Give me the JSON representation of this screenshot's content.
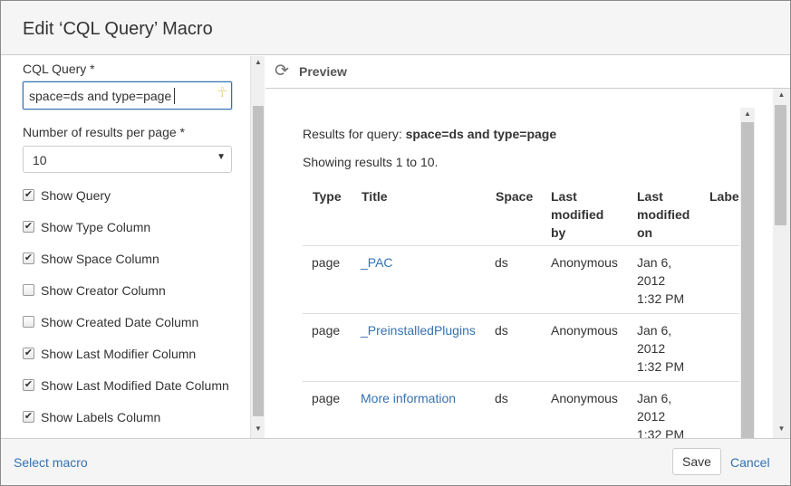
{
  "dialog": {
    "title": "Edit ‘CQL Query’ Macro"
  },
  "form": {
    "query_label": "CQL Query *",
    "query_value": "space=ds and type=page",
    "results_label": "Number of results per page *",
    "results_value": "10",
    "checkboxes": [
      {
        "label": "Show Query",
        "checked": true
      },
      {
        "label": "Show Type Column",
        "checked": true
      },
      {
        "label": "Show Space Column",
        "checked": true
      },
      {
        "label": "Show Creator Column",
        "checked": false
      },
      {
        "label": "Show Created Date Column",
        "checked": false
      },
      {
        "label": "Show Last Modifier Column",
        "checked": true
      },
      {
        "label": "Show Last Modified Date Column",
        "checked": true
      },
      {
        "label": "Show Labels Column",
        "checked": true
      }
    ]
  },
  "preview": {
    "label": "Preview",
    "results_prefix": "Results for query: ",
    "results_query": "space=ds and type=page",
    "showing": "Showing results 1 to 10.",
    "columns": {
      "type": "Type",
      "title": "Title",
      "space": "Space",
      "last_modified_by": "Last\nmodified\nby",
      "last_modified_on": "Last\nmodified\non",
      "labels": "Labe"
    },
    "rows": [
      {
        "type": "page",
        "title": "_PAC",
        "space": "ds",
        "modifier": "Anonymous",
        "date_line1": "Jan 6,",
        "date_line2": "2012",
        "date_line3": "1:32 PM"
      },
      {
        "type": "page",
        "title": "_PreinstalledPlugins",
        "space": "ds",
        "modifier": "Anonymous",
        "date_line1": "Jan 6,",
        "date_line2": "2012",
        "date_line3": "1:32 PM"
      },
      {
        "type": "page",
        "title": "More information",
        "space": "ds",
        "modifier": "Anonymous",
        "date_line1": "Jan 6,",
        "date_line2": "2012",
        "date_line3": "1:32 PM"
      }
    ]
  },
  "footer": {
    "select_macro": "Select macro",
    "save": "Save",
    "cancel": "Cancel"
  },
  "colors": {
    "link": "#3572b0",
    "header_bg": "#f5f5f5",
    "border": "#cccccc"
  },
  "icons": {
    "refresh": "refresh-icon",
    "select_arrow": "caret-down-icon",
    "input_decoration": "ankh-icon"
  }
}
